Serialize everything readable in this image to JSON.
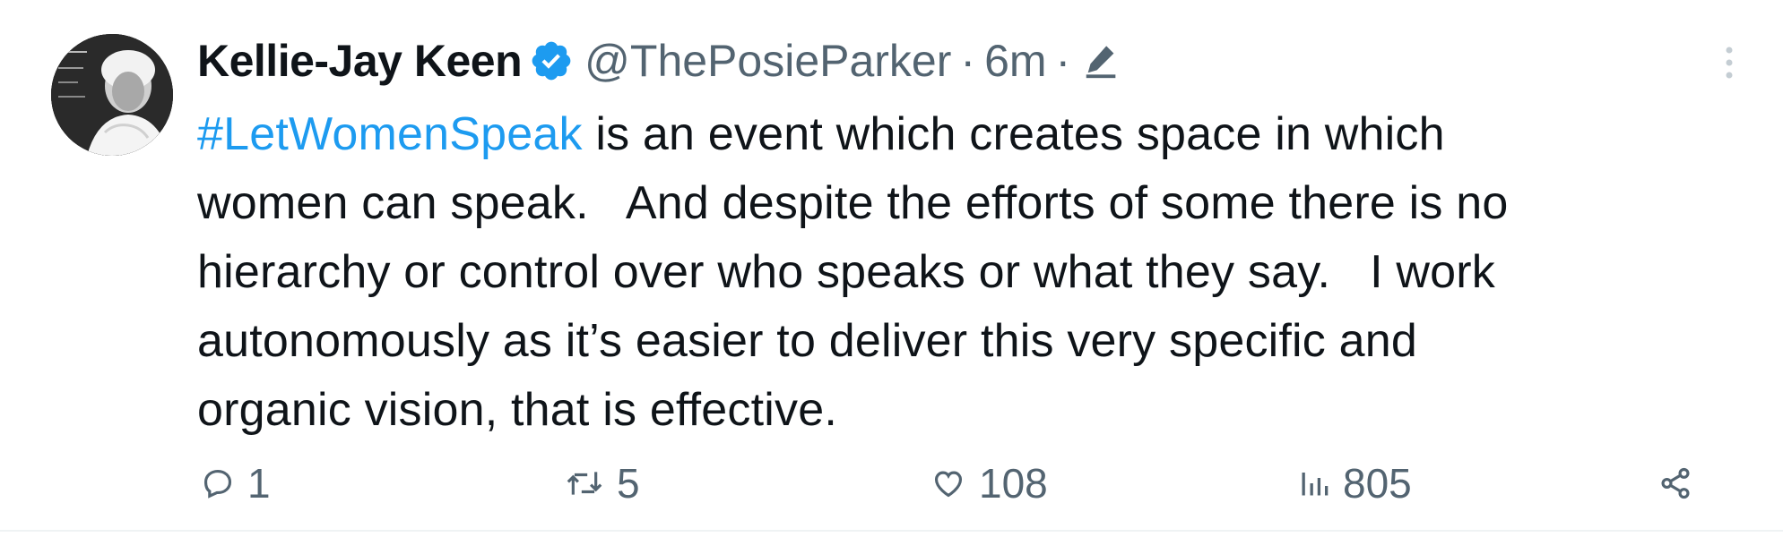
{
  "tweet": {
    "author": {
      "name": "Kellie-Jay Keen",
      "handle": "@ThePosieParker",
      "verified": true
    },
    "separator": "·",
    "time": "6m",
    "edited_icon": "pencil-edit-icon",
    "more_icon": "vertical-ellipsis-icon",
    "text": {
      "hashtag": "#LetWomenSpeak",
      "line1_rest": " is an event which creates space in which",
      "line2": "women can speak.   And despite the efforts of some there is no",
      "line3": "hierarchy or control over who speaks or what they say.   I work",
      "line4": "autonomously as it’s easier to deliver this very specific and",
      "line5": "organic vision, that is effective."
    },
    "actions": {
      "replies": "1",
      "retweets": "5",
      "likes": "108",
      "views": "805",
      "reply_icon": "reply-bubble-icon",
      "retweet_icon": "retweet-icon",
      "like_icon": "heart-icon",
      "views_icon": "bar-chart-icon",
      "share_icon": "share-icon"
    },
    "colors": {
      "link": "#1d9bf0",
      "text": "#0f1419",
      "secondary": "#536471",
      "verified": "#1d9bf0"
    }
  }
}
